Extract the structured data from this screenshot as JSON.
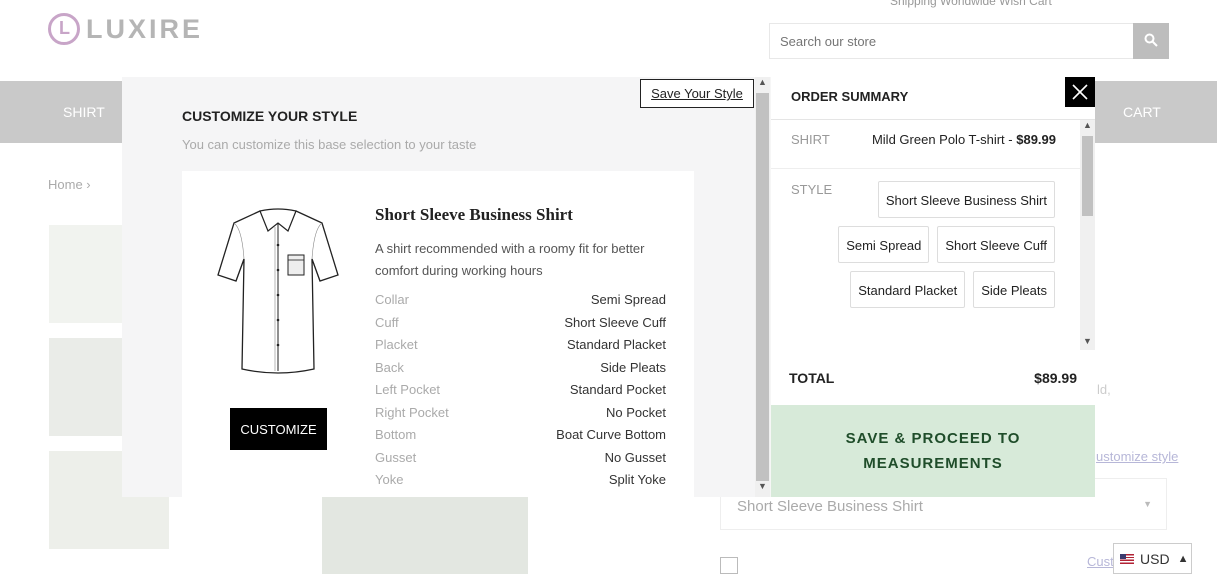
{
  "header": {
    "top_strip": "Shipping Worldwide     Wish     Cart",
    "logo_text": "LUXIRE",
    "search": {
      "placeholder": "Search our store"
    }
  },
  "nav": {
    "shirt_label": "SHIRT",
    "cart_label": "CART"
  },
  "breadcrumb": "Home   ›",
  "background": {
    "right_fragment": "ld,",
    "customize_link": "ustomize style",
    "style_select_value": "Short Sleeve Business Shirt",
    "cust_link": "Cust"
  },
  "currency": {
    "code": "USD"
  },
  "modal": {
    "save_style_label": "Save Your Style",
    "customize": {
      "title": "CUSTOMIZE YOUR STYLE",
      "subtitle": "You can customize this base selection to your taste",
      "style_name": "Short Sleeve Business Shirt",
      "description": "A shirt recommended with a roomy fit for better comfort during working hours",
      "button_label": "CUSTOMIZE",
      "specs": [
        {
          "label": "Collar",
          "value": "Semi Spread"
        },
        {
          "label": "Cuff",
          "value": "Short Sleeve Cuff"
        },
        {
          "label": "Placket",
          "value": "Standard Placket"
        },
        {
          "label": "Back",
          "value": "Side Pleats"
        },
        {
          "label": "Left Pocket",
          "value": "Standard Pocket"
        },
        {
          "label": "Right Pocket",
          "value": "No Pocket"
        },
        {
          "label": "Bottom",
          "value": "Boat Curve Bottom"
        },
        {
          "label": "Gusset",
          "value": "No Gusset"
        },
        {
          "label": "Yoke",
          "value": "Split Yoke"
        }
      ]
    },
    "order_summary": {
      "title": "ORDER SUMMARY",
      "close_icon": "close-icon",
      "shirt_label": "SHIRT",
      "shirt_name": "Mild Green Polo T-shirt - ",
      "shirt_price": "$89.99",
      "style_label": "STYLE",
      "style_chips": [
        "Short Sleeve Business Shirt",
        "Semi Spread",
        "Short Sleeve Cuff",
        "Standard Placket",
        "Side Pleats"
      ],
      "total_label": "TOTAL",
      "total_value": "$89.99",
      "proceed_line1": "SAVE & PROCEED TO",
      "proceed_line2": "MEASUREMENTS"
    }
  },
  "colors": {
    "nav_bg": "#c9c9c9",
    "proceed_bg": "#d7ead9",
    "proceed_text": "#1f4d2a",
    "accent_black": "#000000"
  }
}
